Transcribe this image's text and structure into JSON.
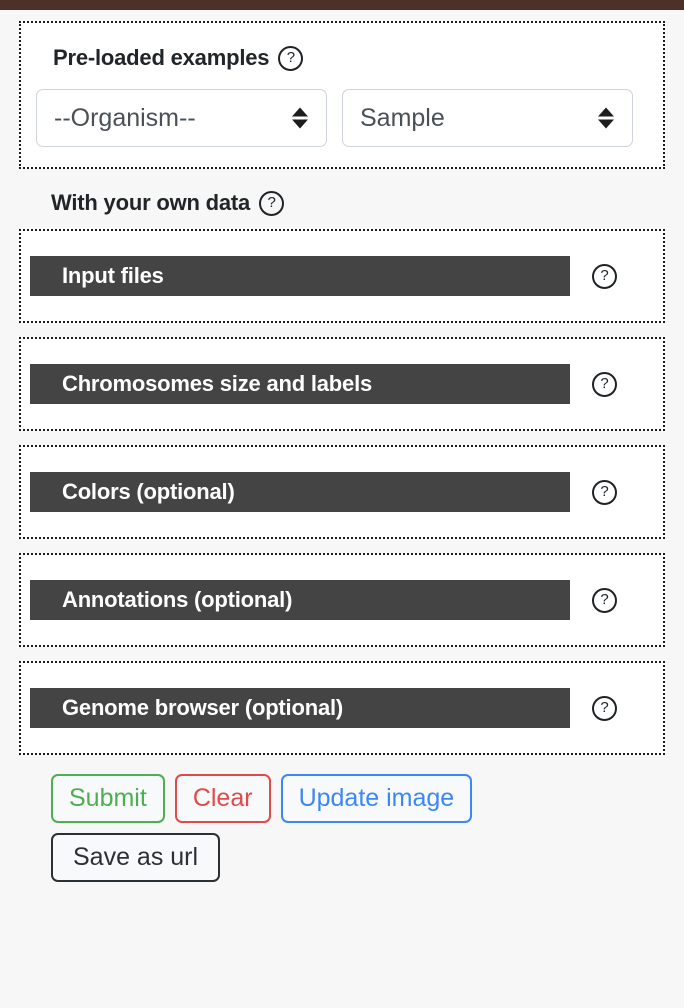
{
  "topbar": {
    "color": "#4e302b"
  },
  "preloaded": {
    "heading": "Pre-loaded examples",
    "help_icon_label": "?",
    "selects": [
      {
        "name": "organism",
        "value": "--Organism--"
      },
      {
        "name": "sample",
        "value": "Sample"
      }
    ]
  },
  "own_data": {
    "heading": "With your own data",
    "help_icon_label": "?",
    "sections": [
      {
        "id": "input-files",
        "label": "Input files",
        "help_icon_label": "?"
      },
      {
        "id": "chromosomes-size-and-labels",
        "label": "Chromosomes size and labels",
        "help_icon_label": "?"
      },
      {
        "id": "colors-optional",
        "label": "Colors (optional)",
        "help_icon_label": "?"
      },
      {
        "id": "annotations-optional",
        "label": "Annotations (optional)",
        "help_icon_label": "?"
      },
      {
        "id": "genome-browser-optional",
        "label": "Genome browser (optional)",
        "help_icon_label": "?"
      }
    ]
  },
  "buttons": {
    "submit": "Submit",
    "clear": "Clear",
    "update_image": "Update image",
    "save_as_url": "Save as url"
  },
  "colors": {
    "topbar": "#4e302b",
    "section_bar": "#444444",
    "submit": "#4caf50",
    "clear": "#e04a4a",
    "update": "#3c87f7",
    "save": "#2b3035",
    "page_background": "#f7f7f7"
  }
}
